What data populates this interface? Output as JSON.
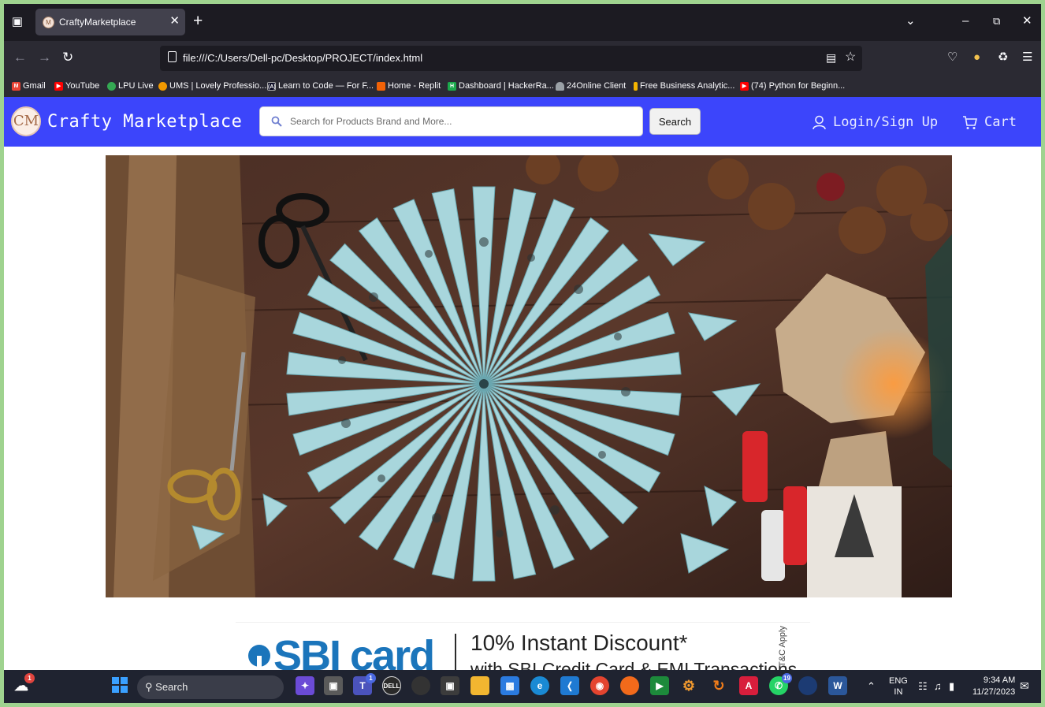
{
  "browser": {
    "tab_title": "CraftyMarketplace",
    "url": "file:///C:/Users/Dell-pc/Desktop/PROJECT/index.html",
    "bookmarks": [
      {
        "label": "Gmail",
        "color": "#ea4335"
      },
      {
        "label": "YouTube",
        "color": "#ff0000"
      },
      {
        "label": "LPU Live",
        "color": "#34a853"
      },
      {
        "label": "UMS | Lovely Professio...",
        "color": "#f29900"
      },
      {
        "label": "Learn to Code — For F...",
        "color": "#0a0a23"
      },
      {
        "label": "Home - Replit",
        "color": "#f26207"
      },
      {
        "label": "Dashboard | HackerRa...",
        "color": "#1ba94c"
      },
      {
        "label": "24Online Client",
        "color": "#9aa0a6"
      },
      {
        "label": "Free Business Analytic...",
        "color": "#f4b400"
      },
      {
        "label": "(74) Python for Beginn...",
        "color": "#ff0000"
      }
    ]
  },
  "site": {
    "logo_text": "CM",
    "brand": "Crafty Marketplace",
    "search_placeholder": "Search for Products Brand and More...",
    "search_button": "Search",
    "login_label": "Login/Sign Up",
    "cart_label": "Cart",
    "header_color": "#3c45fb"
  },
  "promo": {
    "brand": "SBI card",
    "title": "10% Instant Discount*",
    "subtitle": "with SBI Credit Card & EMI Transactions",
    "terms": "T&C Apply"
  },
  "taskbar": {
    "search_label": "Search",
    "weather_badge": "1",
    "teams_badge": "1",
    "whatsapp_badge": "19",
    "language": "ENG",
    "region": "IN",
    "time": "9:34 AM",
    "date": "11/27/2023"
  }
}
